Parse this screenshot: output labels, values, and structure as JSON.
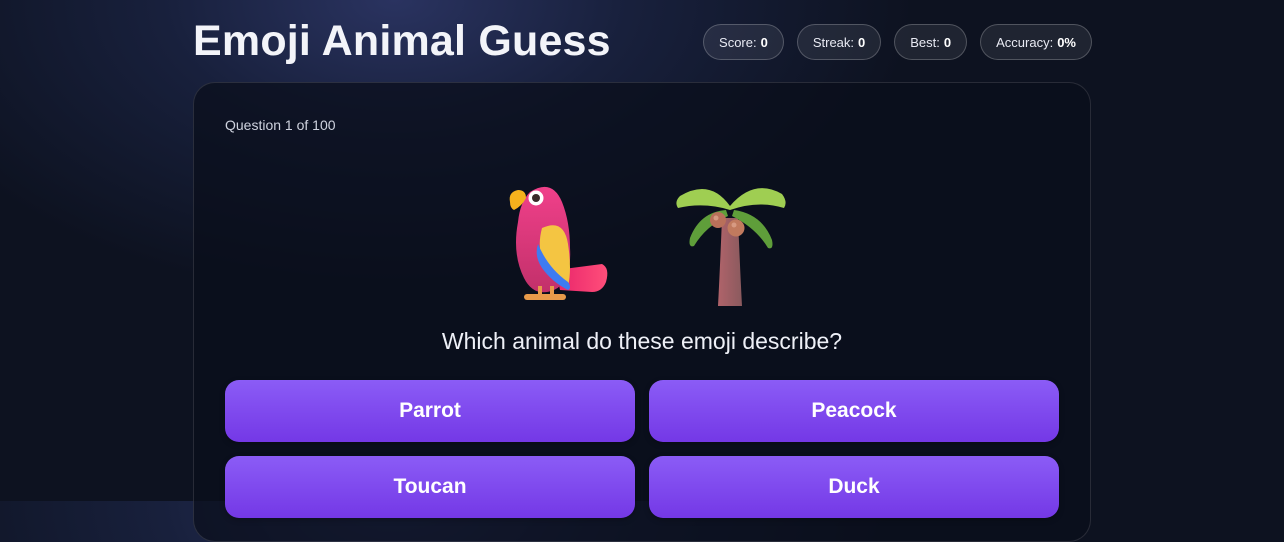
{
  "header": {
    "title": "Emoji Animal Guess",
    "stats": [
      {
        "label": "Score:",
        "value": "0"
      },
      {
        "label": "Streak:",
        "value": "0"
      },
      {
        "label": "Best:",
        "value": "0"
      },
      {
        "label": "Accuracy:",
        "value": "0%"
      }
    ]
  },
  "game": {
    "progress": "Question 1 of 100",
    "emojis": [
      "parrot-emoji",
      "palm-tree-emoji"
    ],
    "question": "Which animal do these emoji describe?",
    "answers": [
      "Parrot",
      "Peacock",
      "Toucan",
      "Duck"
    ]
  },
  "colors": {
    "answer_top": "#8b5cf6",
    "answer_bottom": "#7438e6",
    "background": "#0d1220"
  }
}
